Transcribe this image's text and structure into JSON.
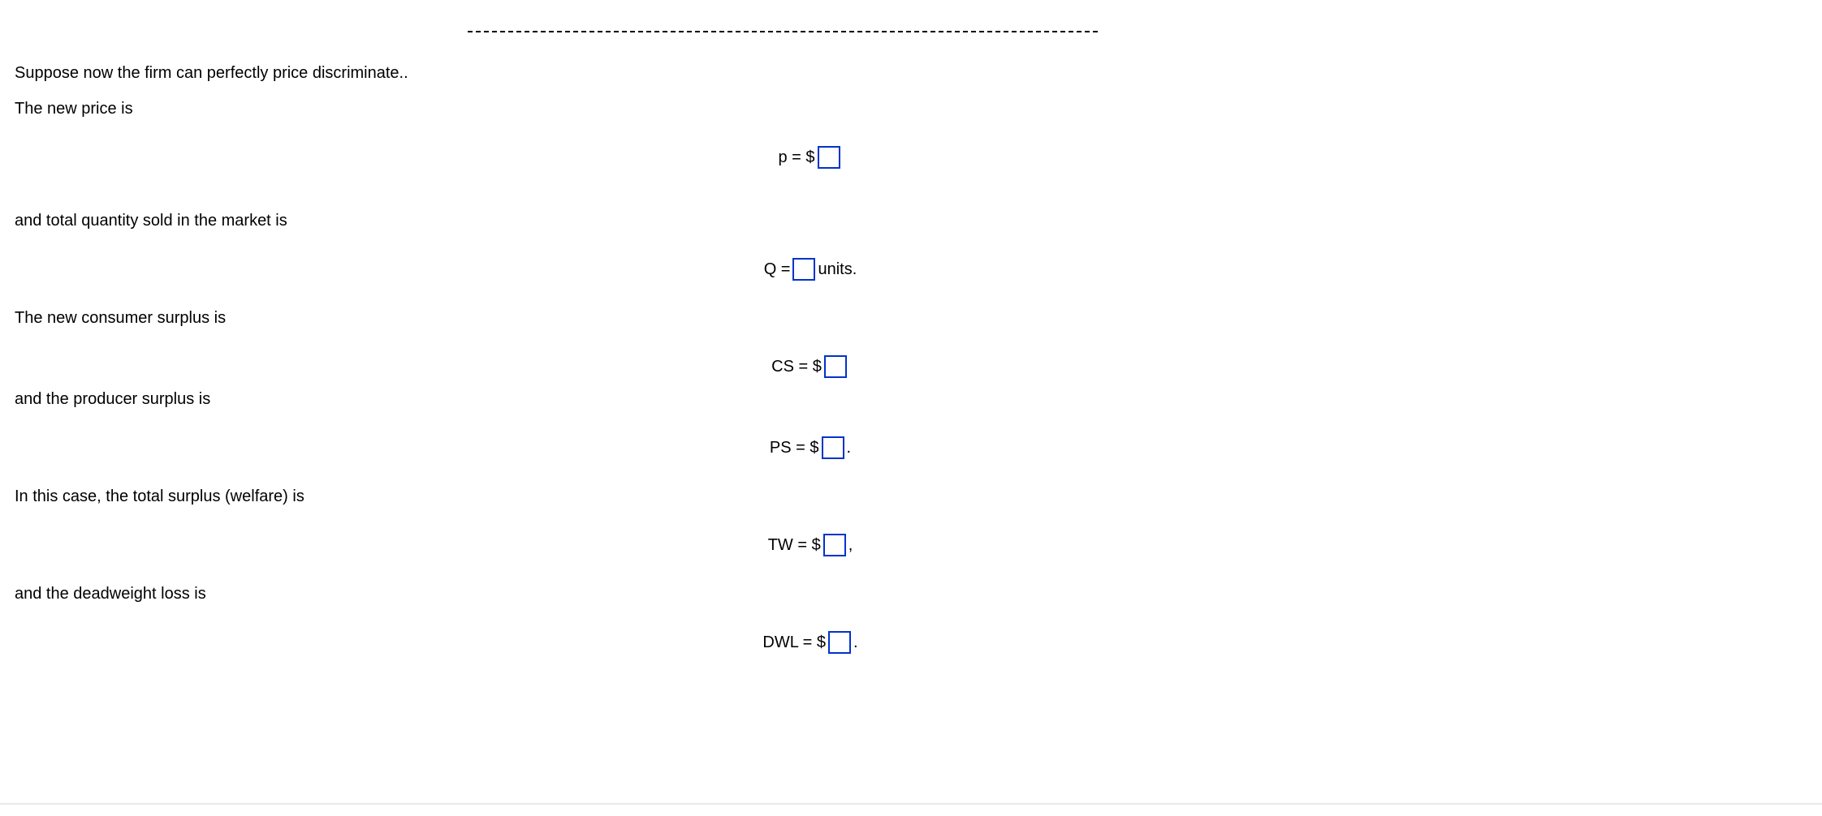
{
  "intro": "Suppose now the firm can perfectly price discriminate..",
  "lines": {
    "price_prompt": "The new price is",
    "quantity_prompt": "and total quantity sold in the market is",
    "cs_prompt": "The new consumer surplus is",
    "ps_prompt": "and the producer surplus is",
    "tw_prompt": "In this case, the total surplus (welfare) is",
    "dwl_prompt": "and the deadweight loss is"
  },
  "equations": {
    "p_label": "p = $",
    "q_label_pre": "Q = ",
    "q_label_post": " units.",
    "cs_label": "CS = $",
    "ps_label": "PS = $",
    "ps_suffix": ".",
    "tw_label": "TW = $",
    "tw_suffix": ",",
    "dwl_label": "DWL = $",
    "dwl_suffix": "."
  }
}
